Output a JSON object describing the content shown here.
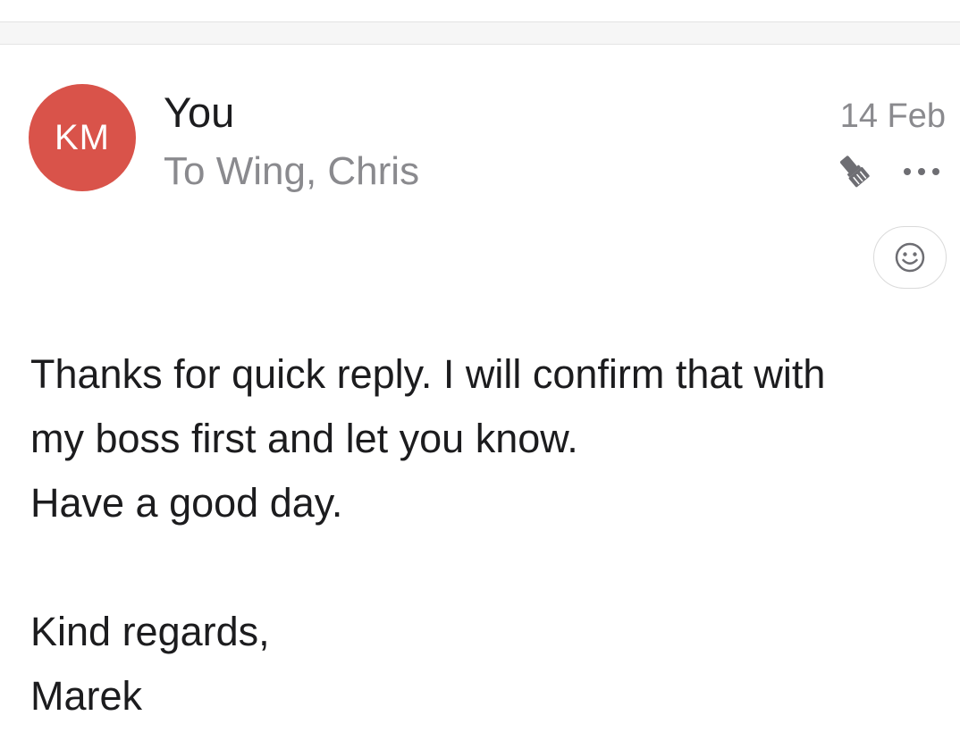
{
  "message": {
    "avatar_initials": "KM",
    "avatar_color": "#D9534A",
    "sender": "You",
    "recipients": "To Wing, Chris",
    "date": "14 Feb",
    "body_lines": [
      "Thanks for quick reply. I will confirm that with",
      "my boss first and let you know.",
      "Have a good day."
    ],
    "signoff_lines": [
      "Kind regards,",
      "Marek"
    ]
  },
  "icons": {
    "brush": "paintbrush-icon",
    "more": "ellipsis-icon",
    "reaction": "smiley-face-icon"
  }
}
